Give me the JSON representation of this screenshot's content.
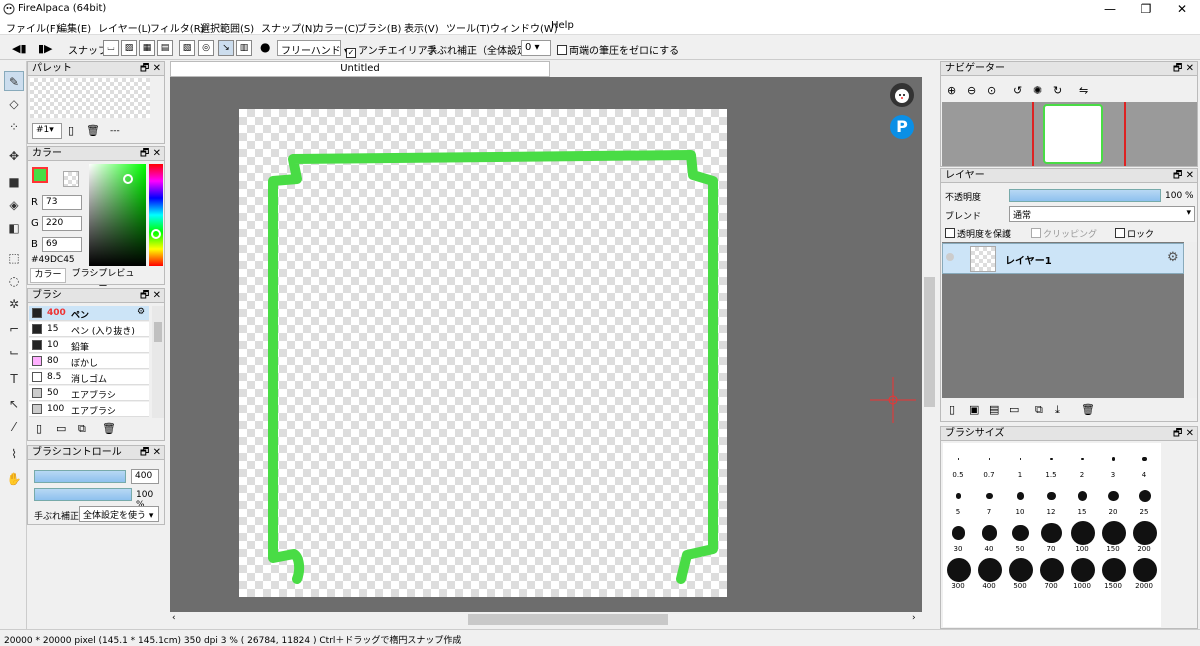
{
  "window": {
    "title": "FireAlpaca (64bit)"
  },
  "menu": [
    "ファイル(F)",
    "編集(E)",
    "レイヤー(L)",
    "フィルタ(R)",
    "選択範囲(S)",
    "スナップ(N)",
    "カラー(C)",
    "ブラシ(B)",
    "表示(V)",
    "ツール(T)",
    "ウィンドウ(W)",
    "Help"
  ],
  "toolbar": {
    "snap_label": "スナップ",
    "mode": "フリーハンド",
    "antialias_label": "アンチエイリアス",
    "antialias_checked": true,
    "stabilizer_label": "手ぶれ補正（全体設定）",
    "stabilizer_value": "0",
    "pressure_label": "両端の筆圧をゼロにする"
  },
  "palette": {
    "title": "パレット",
    "selector": "#1",
    "name": "---"
  },
  "color": {
    "title": "カラー",
    "r_label": "R",
    "r": "73",
    "g_label": "G",
    "g": "220",
    "b_label": "B",
    "b": "69",
    "hex": "#49DC45",
    "current": "#49DC45",
    "tabs": [
      "カラー",
      "ブラシプレビュー"
    ]
  },
  "brush": {
    "title": "ブラシ",
    "items": [
      {
        "size": "400",
        "name": "ペン",
        "color": "#222222",
        "selected": true
      },
      {
        "size": "15",
        "name": "ペン (入り抜き)",
        "color": "#222222"
      },
      {
        "size": "10",
        "name": "鉛筆",
        "color": "#222222"
      },
      {
        "size": "80",
        "name": "ぼかし",
        "color": "#ffb0ff"
      },
      {
        "size": "8.5",
        "name": "消しゴム",
        "color": "#ffffff"
      },
      {
        "size": "50",
        "name": "エアブラシ",
        "color": "#cccccc"
      },
      {
        "size": "100",
        "name": "エアブラシ",
        "color": "#cccccc"
      }
    ]
  },
  "brush_control": {
    "title": "ブラシコントロール",
    "size": "400",
    "opacity": "100 %",
    "stabilizer_label": "手ぶれ補正",
    "stabilizer_value": "全体設定を使う"
  },
  "canvas": {
    "tab": "Untitled",
    "stroke_color": "#49DC45"
  },
  "navigator": {
    "title": "ナビゲーター"
  },
  "layer": {
    "title": "レイヤー",
    "opacity_label": "不透明度",
    "opacity": "100 %",
    "opacity_level": 1.0,
    "blend_label": "ブレンド",
    "blend": "通常",
    "protect_label": "透明度を保護",
    "clip_label": "クリッピング",
    "lock_label": "ロック",
    "layers": [
      {
        "name": "レイヤー1"
      }
    ]
  },
  "brush_size": {
    "title": "ブラシサイズ",
    "sizes": [
      "0.5",
      "0.7",
      "1",
      "1.5",
      "2",
      "3",
      "4",
      "5",
      "7",
      "10",
      "12",
      "15",
      "20",
      "25",
      "30",
      "40",
      "50",
      "70",
      "100",
      "150",
      "200",
      "300",
      "400",
      "500",
      "700",
      "1000",
      "1500",
      "2000"
    ]
  },
  "status": {
    "size": "20000 * 20000 pixel",
    "cm": "(145.1 * 145.1cm)",
    "dpi": "350 dpi",
    "zoom": "3 %",
    "coords": "( 26784, 11824 )",
    "hint": "Ctrl＋ドラッグで楕円スナップ作成"
  }
}
